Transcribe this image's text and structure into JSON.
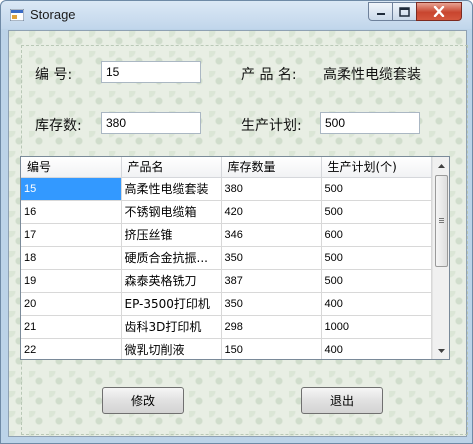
{
  "window": {
    "title": "Storage"
  },
  "form": {
    "id_label": "编  号:",
    "id_value": "15",
    "name_label": "产 品 名:",
    "name_value": "高柔性电缆套装",
    "stock_label": "库存数:",
    "stock_value": "380",
    "plan_label": "生产计划:",
    "plan_value": "500"
  },
  "grid": {
    "columns": [
      "编号",
      "产品名",
      "库存数量",
      "生产计划(个)"
    ],
    "rows": [
      [
        "15",
        "高柔性电缆套装",
        "380",
        "500"
      ],
      [
        "16",
        "不锈钢电缆箱",
        "420",
        "500"
      ],
      [
        "17",
        "挤压丝锥",
        "346",
        "600"
      ],
      [
        "18",
        "硬质合金抗振...",
        "350",
        "500"
      ],
      [
        "19",
        "森泰英格铣刀",
        "387",
        "500"
      ],
      [
        "20",
        "EP-3500打印机",
        "350",
        "400"
      ],
      [
        "21",
        "齿科3D打印机",
        "298",
        "1000"
      ],
      [
        "22",
        "微乳切削液",
        "150",
        "400"
      ]
    ]
  },
  "buttons": {
    "modify": "修改",
    "exit": "退出"
  },
  "colors": {
    "selection": "#3399ff",
    "close_button": "#c8452f"
  }
}
